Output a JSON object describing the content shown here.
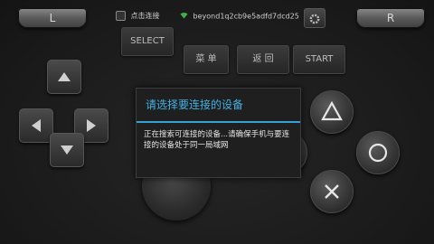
{
  "shoulders": {
    "left": "L",
    "right": "R"
  },
  "topbar": {
    "select_hint": "点击连接",
    "wifi_name": "beyond1q2cb9e5adfd7dcd25"
  },
  "buttons": {
    "select": "SELECT",
    "menu": "菜 单",
    "back": "返 回",
    "start": "START"
  },
  "dialog": {
    "title": "请选择要连接的设备",
    "message": "正在搜索可连接的设备...请确保手机与要连接的设备处于同一局域网"
  },
  "icons": {
    "select_icon": "select-icon",
    "wifi_icon": "wifi-icon",
    "gear_icon": "gear-icon"
  },
  "colors": {
    "accent": "#43b1e3",
    "wifi": "#3fb04a",
    "background": "#1e1e1e"
  }
}
